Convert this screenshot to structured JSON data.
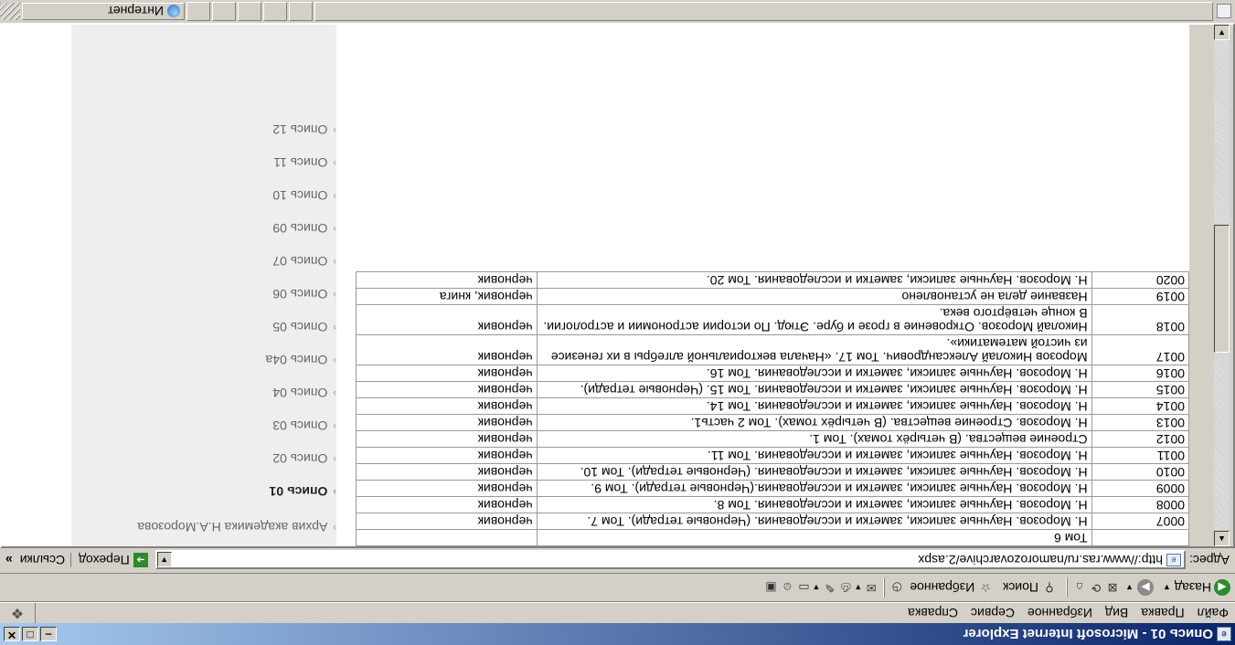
{
  "window": {
    "title": "Опись 01 - Microsoft Internet Explorer",
    "buttons": {
      "minimize": "‒",
      "maximize": "□",
      "close": "✕"
    }
  },
  "menu": [
    "Файл",
    "Правка",
    "Вид",
    "Избранное",
    "Сервис",
    "Справка"
  ],
  "toolbar": {
    "back_label": "Назад",
    "search_label": "Поиск",
    "favorites_label": "Избранное"
  },
  "address": {
    "label": "Адрес:",
    "url": "http://www.ras.ru/namorozovarchive/2.aspx",
    "go_label": "Переход",
    "links_label": "Ссылки",
    "links_chevron": "»"
  },
  "nav": {
    "items": [
      {
        "label": "Архив академика Н.А.Морозова",
        "active": false
      },
      {
        "label": "Опись 01",
        "active": true
      },
      {
        "label": "Опись 02",
        "active": false
      },
      {
        "label": "Опись 03",
        "active": false
      },
      {
        "label": "Опись 04",
        "active": false
      },
      {
        "label": "Опись 04а",
        "active": false
      },
      {
        "label": "Опись 05",
        "active": false
      },
      {
        "label": "Опись 06",
        "active": false
      },
      {
        "label": "Опись 07",
        "active": false
      },
      {
        "label": "Опись 09",
        "active": false
      },
      {
        "label": "Опись 10",
        "active": false
      },
      {
        "label": "Опись 11",
        "active": false
      },
      {
        "label": "Опись 12",
        "active": false
      }
    ]
  },
  "table": {
    "rows": [
      {
        "num": "",
        "title": "Том 6",
        "type": ""
      },
      {
        "num": "0007",
        "title": "Н. Морозов. Научные записки, заметки и исследования. (Черновые тетради). Том 7.",
        "type": "черновик"
      },
      {
        "num": "0008",
        "title": "Н. Морозов. Научные записки, заметки и исследования. Том 8.",
        "type": "черновик"
      },
      {
        "num": "0009",
        "title": "Н. Морозов. Научные записки, заметки и исследования.(Черновые тетради). Том 9.",
        "type": "черновик"
      },
      {
        "num": "0010",
        "title": "Н. Морозов. Научные записки, заметки и исследования. (Черновые тетради). Том 10.",
        "type": "черновик"
      },
      {
        "num": "0011",
        "title": "Н. Морозов. Научные записки, заметки и исследования. Том 11.",
        "type": "черновик"
      },
      {
        "num": "0012",
        "title": "Строение вещества. (В четырёх томах). Том 1.",
        "type": "черновик"
      },
      {
        "num": "0013",
        "title": "Н. Морозов. Строение вещества. (В четырёх томах). Том 2 часть1.",
        "type": "черновик"
      },
      {
        "num": "0014",
        "title": "Н. Морозов. Научные записки, заметки и исследования. Том 14.",
        "type": "черновик"
      },
      {
        "num": "0015",
        "title": "Н. Морозов. Научные записки, заметки и исследования. Том 15. (Черновые тетради).",
        "type": "черновик"
      },
      {
        "num": "0016",
        "title": "Н. Морозов. Научные записки, заметки и исследования. Том 16.",
        "type": "черновик"
      },
      {
        "num": "0017",
        "title": "Морозов Николай Александрович. Том 17. «Начала векториальной алгебры в их генезисе из чистой математики».",
        "type": "черновик"
      },
      {
        "num": "0018",
        "title": "Николай Морозов. Откровение в грозе и буре. Этюд. По истории астрономии и астрологии. В конце четвёртого века.",
        "type": "черновик"
      },
      {
        "num": "0019",
        "title": "Название дела не установлено",
        "type": "черновик, книга"
      },
      {
        "num": "0020",
        "title": "Н. Морозов. Научные записки, заметки и исследования. Том 20.",
        "type": "черновик"
      }
    ]
  },
  "status": {
    "zone_label": "Интернет"
  }
}
